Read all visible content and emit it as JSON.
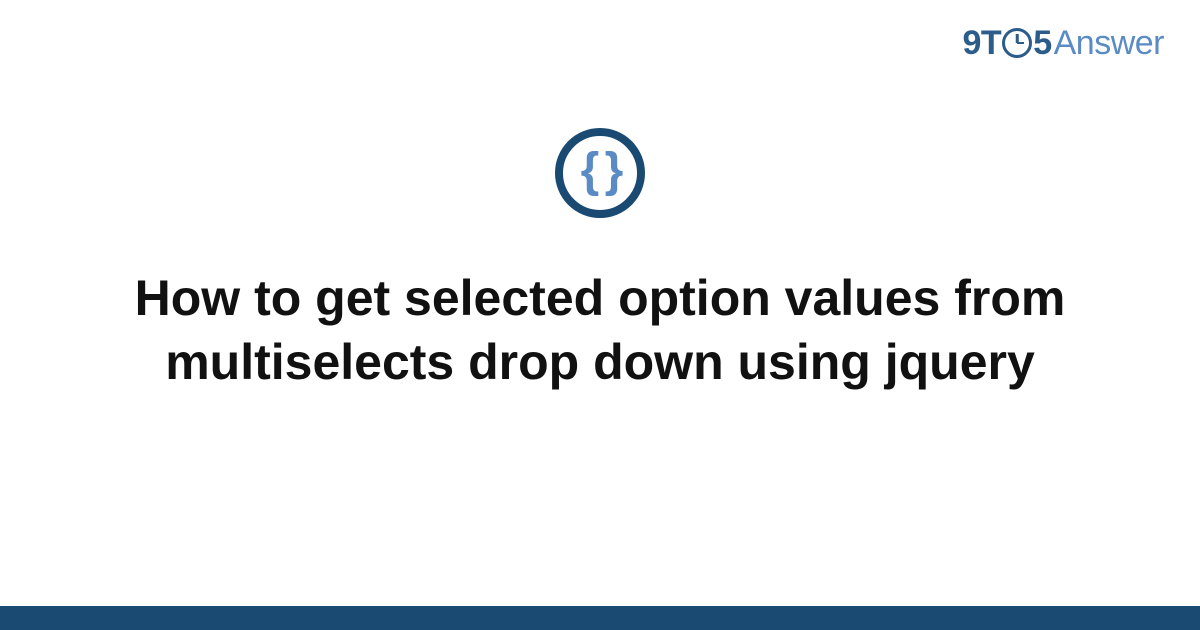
{
  "logo": {
    "nine": "9",
    "t": "T",
    "five": "5",
    "answer": "Answer"
  },
  "icon": {
    "braces": "{ }"
  },
  "title": "How to get selected option values from multiselects drop down using jquery"
}
